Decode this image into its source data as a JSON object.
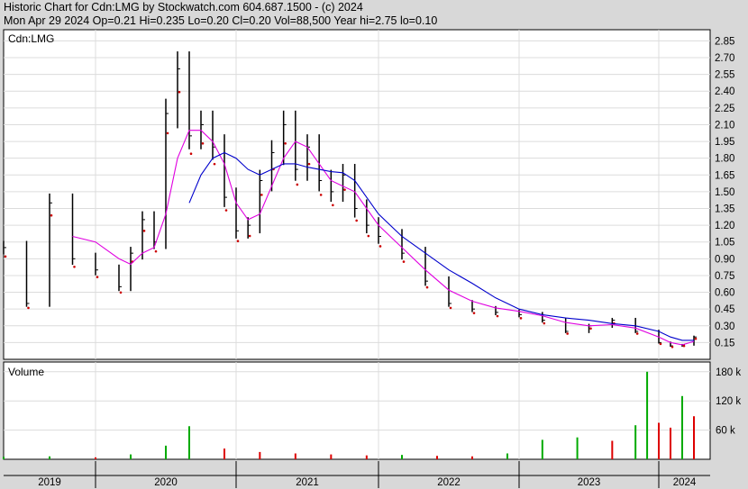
{
  "header": {
    "line1": "Historic Chart for Cdn:LMG by Stockwatch.com 604.687.1500 - (c) 2024",
    "line2": "Mon Apr 29 2024   Op=0.21   Hi=0.235   Lo=0.20   Cl=0.20   Vol=88,500   Year hi=2.75   lo=0.10"
  },
  "price_panel": {
    "label": "Cdn:LMG"
  },
  "volume_panel": {
    "label": "Volume"
  },
  "colors": {
    "background": "#ffffff",
    "frame": "#d8d8d8",
    "grid": "#dcdcdc",
    "price_bars": "#000000",
    "price_dots": "#cc0000",
    "ma_short": "#e000e0",
    "ma_long": "#0000cc",
    "volume_up": "#00aa00",
    "volume_down": "#dd0000"
  },
  "chart_data": [
    {
      "type": "line",
      "title": "Historic Chart for Cdn:LMG",
      "ylim": [
        0.0,
        2.95
      ],
      "yticks": [
        "2.85",
        "2.70",
        "2.55",
        "2.40",
        "2.25",
        "2.10",
        "1.95",
        "1.80",
        "1.65",
        "1.50",
        "1.35",
        "1.20",
        "1.05",
        "0.90",
        "0.75",
        "0.60",
        "0.45",
        "0.30",
        "0.15"
      ],
      "xticks": [
        "2019",
        "2020",
        "2021",
        "2022",
        "2023",
        "2024"
      ],
      "grid": true,
      "x": [
        "2019-01",
        "2019-04",
        "2019-07",
        "2019-10",
        "2020-01",
        "2020-03",
        "2020-04",
        "2020-05",
        "2020-06",
        "2020-07",
        "2020-08",
        "2020-09",
        "2020-10",
        "2020-11",
        "2020-12",
        "2021-01",
        "2021-02",
        "2021-03",
        "2021-04",
        "2021-05",
        "2021-06",
        "2021-07",
        "2021-08",
        "2021-09",
        "2021-10",
        "2021-11",
        "2021-12",
        "2022-01",
        "2022-03",
        "2022-05",
        "2022-07",
        "2022-09",
        "2022-11",
        "2023-01",
        "2023-03",
        "2023-05",
        "2023-07",
        "2023-09",
        "2023-11",
        "2024-01",
        "2024-02",
        "2024-03",
        "2024-04"
      ],
      "series": [
        {
          "name": "Price",
          "values": [
            1.0,
            0.5,
            1.4,
            0.9,
            0.8,
            0.65,
            0.95,
            1.25,
            1.05,
            2.2,
            2.6,
            2.0,
            2.1,
            1.9,
            1.45,
            1.15,
            1.2,
            1.6,
            1.85,
            2.1,
            1.7,
            1.9,
            1.6,
            1.5,
            1.65,
            1.35,
            1.2,
            1.1,
            0.95,
            0.7,
            0.5,
            0.45,
            0.42,
            0.4,
            0.35,
            0.25,
            0.3,
            0.35,
            0.25,
            0.15,
            0.12,
            0.13,
            0.2
          ]
        },
        {
          "name": "Short moving average",
          "values": [
            null,
            null,
            null,
            1.1,
            1.05,
            0.9,
            0.85,
            0.95,
            1.0,
            1.3,
            1.8,
            2.05,
            2.05,
            1.95,
            1.75,
            1.4,
            1.25,
            1.3,
            1.55,
            1.8,
            1.95,
            1.9,
            1.75,
            1.6,
            1.55,
            1.5,
            1.35,
            1.2,
            1.0,
            0.8,
            0.62,
            0.52,
            0.46,
            0.43,
            0.39,
            0.33,
            0.3,
            0.31,
            0.28,
            0.2,
            0.15,
            0.13,
            0.16
          ]
        },
        {
          "name": "Long moving average",
          "values": [
            null,
            null,
            null,
            null,
            null,
            null,
            null,
            null,
            null,
            null,
            null,
            1.4,
            1.65,
            1.8,
            1.85,
            1.8,
            1.7,
            1.65,
            1.7,
            1.75,
            1.75,
            1.72,
            1.7,
            1.68,
            1.67,
            1.6,
            1.45,
            1.3,
            1.1,
            0.95,
            0.8,
            0.68,
            0.55,
            0.45,
            0.4,
            0.37,
            0.35,
            0.32,
            0.3,
            0.25,
            0.2,
            0.17,
            0.17
          ]
        }
      ]
    },
    {
      "type": "bar",
      "title": "Volume",
      "ylim": [
        0,
        200000
      ],
      "yticks": [
        "180 k",
        "120 k",
        "60 k"
      ],
      "grid": true,
      "x": [
        "2019-01",
        "2019-07",
        "2020-01",
        "2020-04",
        "2020-07",
        "2020-09",
        "2020-12",
        "2021-03",
        "2021-06",
        "2021-09",
        "2021-12",
        "2022-03",
        "2022-06",
        "2022-09",
        "2022-12",
        "2023-03",
        "2023-06",
        "2023-09",
        "2023-11",
        "2023-12",
        "2024-01",
        "2024-02",
        "2024-03",
        "2024-04"
      ],
      "series": [
        {
          "name": "Volume",
          "values": [
            5000,
            6000,
            4000,
            10000,
            28000,
            68000,
            22000,
            15000,
            12000,
            10000,
            8000,
            9000,
            7000,
            6000,
            12000,
            40000,
            45000,
            38000,
            70000,
            180000,
            75000,
            65000,
            130000,
            88500
          ]
        }
      ]
    }
  ]
}
